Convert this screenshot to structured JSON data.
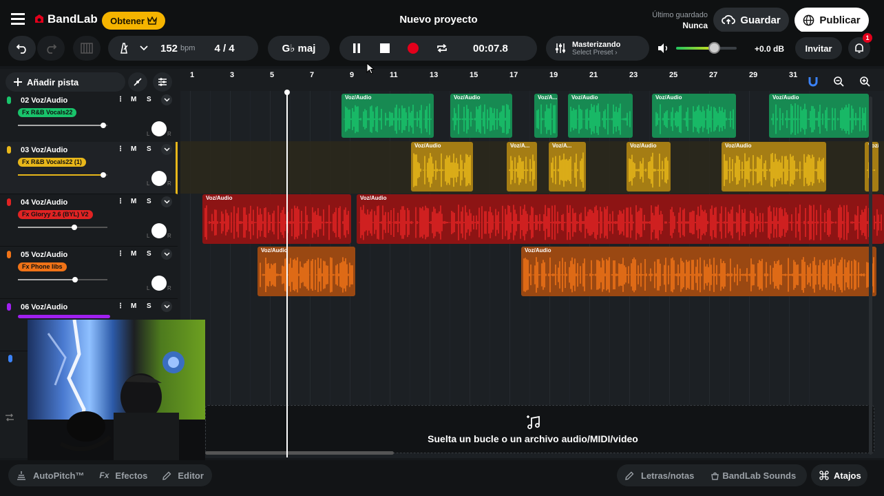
{
  "header": {
    "brand": "BandLab",
    "get_label": "Obtener",
    "project_title": "Nuevo proyecto",
    "last_saved_label": "Último guardado",
    "last_saved_value": "Nunca",
    "save_label": "Guardar",
    "publish_label": "Publicar"
  },
  "toolbar": {
    "tempo_value": "152",
    "tempo_unit": "bpm",
    "time_sig": "4 / 4",
    "key": "G♭ maj",
    "time_display": "00:07.8",
    "mastering_label": "Masterizando",
    "mastering_sub": "Select Preset ›",
    "volume_db": "+0.0 dB",
    "master_volume_fraction": 0.62,
    "invite_label": "Invitar",
    "notification_count": "1"
  },
  "tracks_panel": {
    "add_track_label": "Añadir pista"
  },
  "tracks": [
    {
      "name": "02  Voz/Audio",
      "fx": "Fx R&B Vocals22",
      "color": "#19c46b",
      "volume": 0.95
    },
    {
      "name": "03  Voz/Audio",
      "fx": "Fx R&B Vocals22 (1)",
      "color": "#e8b71a",
      "volume": 0.95
    },
    {
      "name": "04  Voz/Audio",
      "fx": "Fx Gloryy 2.6 (BYL) V2",
      "color": "#e02323",
      "volume": 0.63
    },
    {
      "name": "05  Voz/Audio",
      "fx": "Fx Phone libs",
      "color": "#f07317",
      "volume": 0.64
    },
    {
      "name": "06  Voz/Audio",
      "fx": "",
      "color": "#a020f0",
      "volume": 0.5
    }
  ],
  "track_buttons": {
    "mute": "M",
    "solo": "S",
    "pan_left": "L",
    "pan_right": "R"
  },
  "ruler": [
    "1",
    "3",
    "5",
    "7",
    "9",
    "11",
    "13",
    "15",
    "17",
    "19",
    "21",
    "23",
    "25",
    "27",
    "29",
    "31"
  ],
  "clip_label": "Voz/Audio",
  "clip_label_short": "Voz/A...",
  "dropzone": {
    "text": "Suelta un bucle o un archivo audio/MIDI/video"
  },
  "bottom": {
    "autopitch": "AutoPitch™",
    "effects": "Efectos",
    "editor": "Editor",
    "lyrics": "Letras/notas",
    "sounds": "BandLab Sounds",
    "shortcuts": "Atajos"
  },
  "colors": {
    "accent_yellow": "#f5b400",
    "record_red": "#e3001b"
  }
}
